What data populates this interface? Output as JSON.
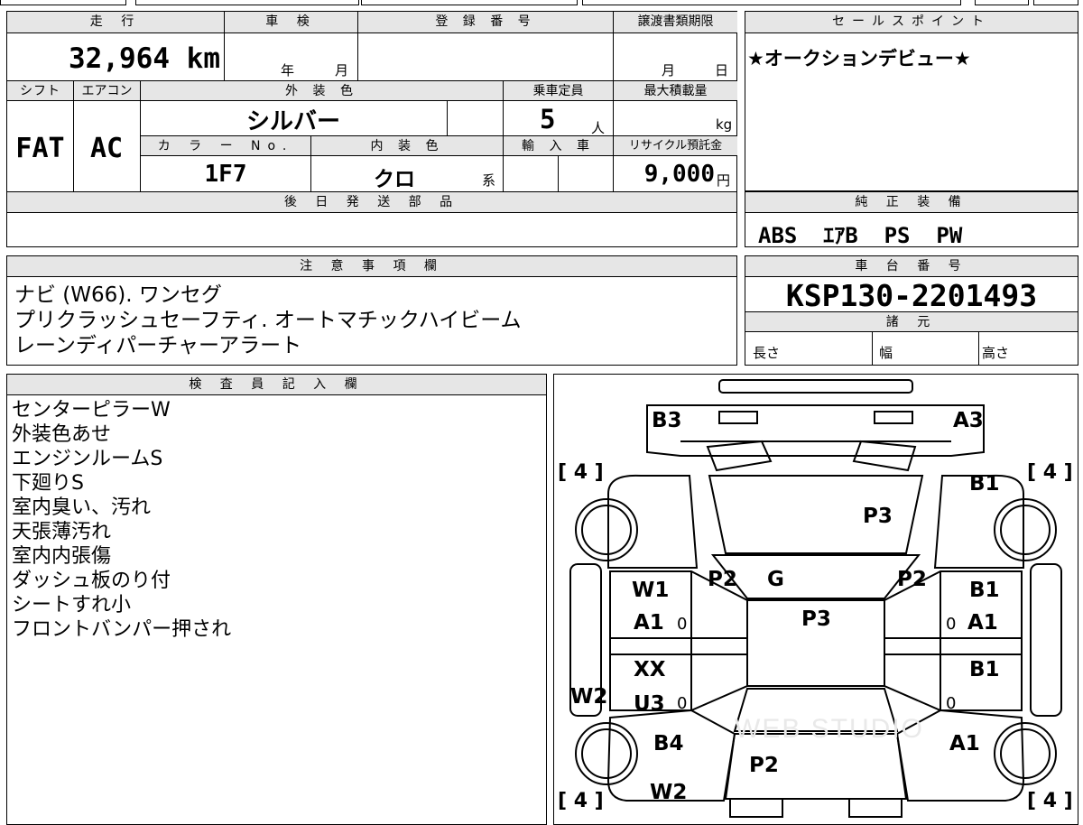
{
  "vehicle": {
    "mileage_label": "走 行",
    "mileage": "32,964 km",
    "inspection_label": "車 検",
    "inspection_year_unit": "年",
    "inspection_month_unit": "月",
    "registration_label": "登 録 番 号",
    "transfer_deadline_label": "譲渡書類期限",
    "transfer_month_unit": "月",
    "transfer_day_unit": "日",
    "shift_label": "シフト",
    "shift": "FAT",
    "ac_label": "エアコン",
    "ac": "AC",
    "exterior_color_label": "外 装 色",
    "exterior_color": "シルバー",
    "capacity_label": "乗車定員",
    "capacity": "5",
    "capacity_unit": "人",
    "max_load_label": "最大積載量",
    "max_load_unit": "kg",
    "color_no_label": "カ ラ ー No.",
    "color_no": "1F7",
    "interior_color_label": "内 装 色",
    "interior_color": "クロ",
    "interior_color_suffix": "系",
    "import_label": "輸 入 車",
    "recycle_label": "リサイクル預託金",
    "recycle_fee": "9,000",
    "recycle_unit": "円",
    "later_parts_label": "後 日 発 送 部 品"
  },
  "sales_point": {
    "label": "セールスポイント",
    "text": "★オークションデビュー★"
  },
  "genuine_equipment": {
    "label": "純 正 装 備",
    "text": "ABS  ｴｱB  PS  PW"
  },
  "notes": {
    "label": "注 意 事 項 欄",
    "lines": [
      "ナビ (W66). ワンセグ",
      "プリクラッシュセーフティ. オートマチックハイビーム",
      "レーンディパーチャーアラート"
    ]
  },
  "chassis": {
    "label": "車 台 番 号",
    "number": "KSP130-2201493",
    "spec_label": "諸 元",
    "length_label": "長さ",
    "width_label": "幅",
    "height_label": "高さ"
  },
  "inspector": {
    "label": "検 査 員 記 入 欄",
    "lines": [
      "センターピラーW",
      "外装色あせ",
      "エンジンルームS",
      "下廻りS",
      "室内臭い、汚れ",
      "天張薄汚れ",
      "室内内張傷",
      "ダッシュ板のり付",
      "シートすれ小",
      "フロントバンパー押され"
    ]
  },
  "diagram": {
    "tire_front_left": "[ 4 ]",
    "tire_front_right": "[ 4 ]",
    "tire_rear_left": "[ 4 ]",
    "tire_rear_right": "[ 4 ]",
    "marks": {
      "front_bumper_left": "B3",
      "front_bumper_right": "A3",
      "fender_right": "B1",
      "hood": "P3",
      "pillar_left": "P2",
      "windshield": "G",
      "pillar_right": "P2",
      "front_door_left_1": "W1",
      "front_door_left_2": "A1",
      "front_door_left_3": "0",
      "roof": "P3",
      "front_door_right_1": "B1",
      "front_door_right_2": "0",
      "front_door_right_3": "A1",
      "rear_door_left_1": "XX",
      "rear_door_left_2": "U3",
      "rear_door_left_3": "0",
      "rocker_left": "W2",
      "rear_door_right_1": "B1",
      "rear_door_right_2": "0",
      "quarter_left": "B4",
      "quarter_right": "A1",
      "trunk": "P2",
      "rear_left": "W2"
    },
    "watermark": "WEB STUDIO"
  }
}
